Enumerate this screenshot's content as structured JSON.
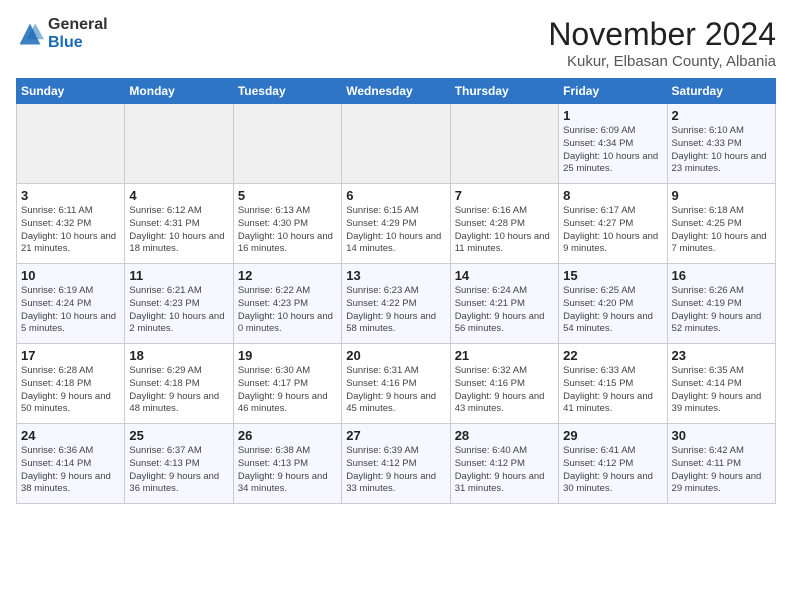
{
  "header": {
    "logo_general": "General",
    "logo_blue": "Blue",
    "month_title": "November 2024",
    "location": "Kukur, Elbasan County, Albania"
  },
  "weekdays": [
    "Sunday",
    "Monday",
    "Tuesday",
    "Wednesday",
    "Thursday",
    "Friday",
    "Saturday"
  ],
  "weeks": [
    [
      {
        "day": "",
        "info": ""
      },
      {
        "day": "",
        "info": ""
      },
      {
        "day": "",
        "info": ""
      },
      {
        "day": "",
        "info": ""
      },
      {
        "day": "",
        "info": ""
      },
      {
        "day": "1",
        "info": "Sunrise: 6:09 AM\nSunset: 4:34 PM\nDaylight: 10 hours and 25 minutes."
      },
      {
        "day": "2",
        "info": "Sunrise: 6:10 AM\nSunset: 4:33 PM\nDaylight: 10 hours and 23 minutes."
      }
    ],
    [
      {
        "day": "3",
        "info": "Sunrise: 6:11 AM\nSunset: 4:32 PM\nDaylight: 10 hours and 21 minutes."
      },
      {
        "day": "4",
        "info": "Sunrise: 6:12 AM\nSunset: 4:31 PM\nDaylight: 10 hours and 18 minutes."
      },
      {
        "day": "5",
        "info": "Sunrise: 6:13 AM\nSunset: 4:30 PM\nDaylight: 10 hours and 16 minutes."
      },
      {
        "day": "6",
        "info": "Sunrise: 6:15 AM\nSunset: 4:29 PM\nDaylight: 10 hours and 14 minutes."
      },
      {
        "day": "7",
        "info": "Sunrise: 6:16 AM\nSunset: 4:28 PM\nDaylight: 10 hours and 11 minutes."
      },
      {
        "day": "8",
        "info": "Sunrise: 6:17 AM\nSunset: 4:27 PM\nDaylight: 10 hours and 9 minutes."
      },
      {
        "day": "9",
        "info": "Sunrise: 6:18 AM\nSunset: 4:25 PM\nDaylight: 10 hours and 7 minutes."
      }
    ],
    [
      {
        "day": "10",
        "info": "Sunrise: 6:19 AM\nSunset: 4:24 PM\nDaylight: 10 hours and 5 minutes."
      },
      {
        "day": "11",
        "info": "Sunrise: 6:21 AM\nSunset: 4:23 PM\nDaylight: 10 hours and 2 minutes."
      },
      {
        "day": "12",
        "info": "Sunrise: 6:22 AM\nSunset: 4:23 PM\nDaylight: 10 hours and 0 minutes."
      },
      {
        "day": "13",
        "info": "Sunrise: 6:23 AM\nSunset: 4:22 PM\nDaylight: 9 hours and 58 minutes."
      },
      {
        "day": "14",
        "info": "Sunrise: 6:24 AM\nSunset: 4:21 PM\nDaylight: 9 hours and 56 minutes."
      },
      {
        "day": "15",
        "info": "Sunrise: 6:25 AM\nSunset: 4:20 PM\nDaylight: 9 hours and 54 minutes."
      },
      {
        "day": "16",
        "info": "Sunrise: 6:26 AM\nSunset: 4:19 PM\nDaylight: 9 hours and 52 minutes."
      }
    ],
    [
      {
        "day": "17",
        "info": "Sunrise: 6:28 AM\nSunset: 4:18 PM\nDaylight: 9 hours and 50 minutes."
      },
      {
        "day": "18",
        "info": "Sunrise: 6:29 AM\nSunset: 4:18 PM\nDaylight: 9 hours and 48 minutes."
      },
      {
        "day": "19",
        "info": "Sunrise: 6:30 AM\nSunset: 4:17 PM\nDaylight: 9 hours and 46 minutes."
      },
      {
        "day": "20",
        "info": "Sunrise: 6:31 AM\nSunset: 4:16 PM\nDaylight: 9 hours and 45 minutes."
      },
      {
        "day": "21",
        "info": "Sunrise: 6:32 AM\nSunset: 4:16 PM\nDaylight: 9 hours and 43 minutes."
      },
      {
        "day": "22",
        "info": "Sunrise: 6:33 AM\nSunset: 4:15 PM\nDaylight: 9 hours and 41 minutes."
      },
      {
        "day": "23",
        "info": "Sunrise: 6:35 AM\nSunset: 4:14 PM\nDaylight: 9 hours and 39 minutes."
      }
    ],
    [
      {
        "day": "24",
        "info": "Sunrise: 6:36 AM\nSunset: 4:14 PM\nDaylight: 9 hours and 38 minutes."
      },
      {
        "day": "25",
        "info": "Sunrise: 6:37 AM\nSunset: 4:13 PM\nDaylight: 9 hours and 36 minutes."
      },
      {
        "day": "26",
        "info": "Sunrise: 6:38 AM\nSunset: 4:13 PM\nDaylight: 9 hours and 34 minutes."
      },
      {
        "day": "27",
        "info": "Sunrise: 6:39 AM\nSunset: 4:12 PM\nDaylight: 9 hours and 33 minutes."
      },
      {
        "day": "28",
        "info": "Sunrise: 6:40 AM\nSunset: 4:12 PM\nDaylight: 9 hours and 31 minutes."
      },
      {
        "day": "29",
        "info": "Sunrise: 6:41 AM\nSunset: 4:12 PM\nDaylight: 9 hours and 30 minutes."
      },
      {
        "day": "30",
        "info": "Sunrise: 6:42 AM\nSunset: 4:11 PM\nDaylight: 9 hours and 29 minutes."
      }
    ]
  ]
}
